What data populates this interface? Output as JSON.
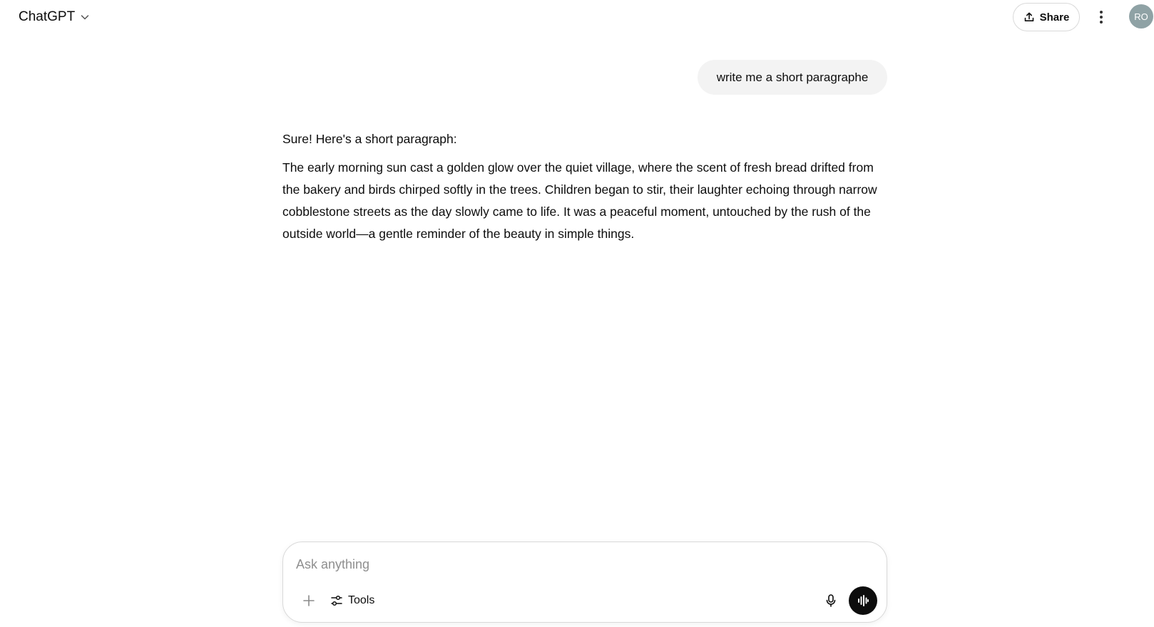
{
  "header": {
    "model_name": "ChatGPT",
    "share_label": "Share",
    "avatar_initials": "RO"
  },
  "conversation": {
    "user_message": "write me a short paragraphe",
    "assistant_intro": "Sure! Here's a short paragraph:",
    "assistant_paragraph": "The early morning sun cast a golden glow over the quiet village, where the scent of fresh bread drifted from the bakery and birds chirped softly in the trees. Children began to stir, their laughter echoing through narrow cobblestone streets as the day slowly came to life. It was a peaceful moment, untouched by the rush of the outside world—a gentle reminder of the beauty in simple things."
  },
  "composer": {
    "placeholder": "Ask anything",
    "value": "",
    "tools_label": "Tools"
  },
  "icons": {
    "model_switcher": "chevron-down-icon",
    "share": "upload-icon",
    "more": "vertical-dots-icon",
    "attach": "plus-icon",
    "tools": "sliders-icon",
    "mic": "microphone-icon",
    "voice": "voice-waveform-icon"
  },
  "colors": {
    "text": "#0d0d0d",
    "user_bubble": "#f3f3f3",
    "avatar_bg": "#8fa2a5",
    "voice_button": "#0d0d0d",
    "border": "#d9d9d9"
  }
}
